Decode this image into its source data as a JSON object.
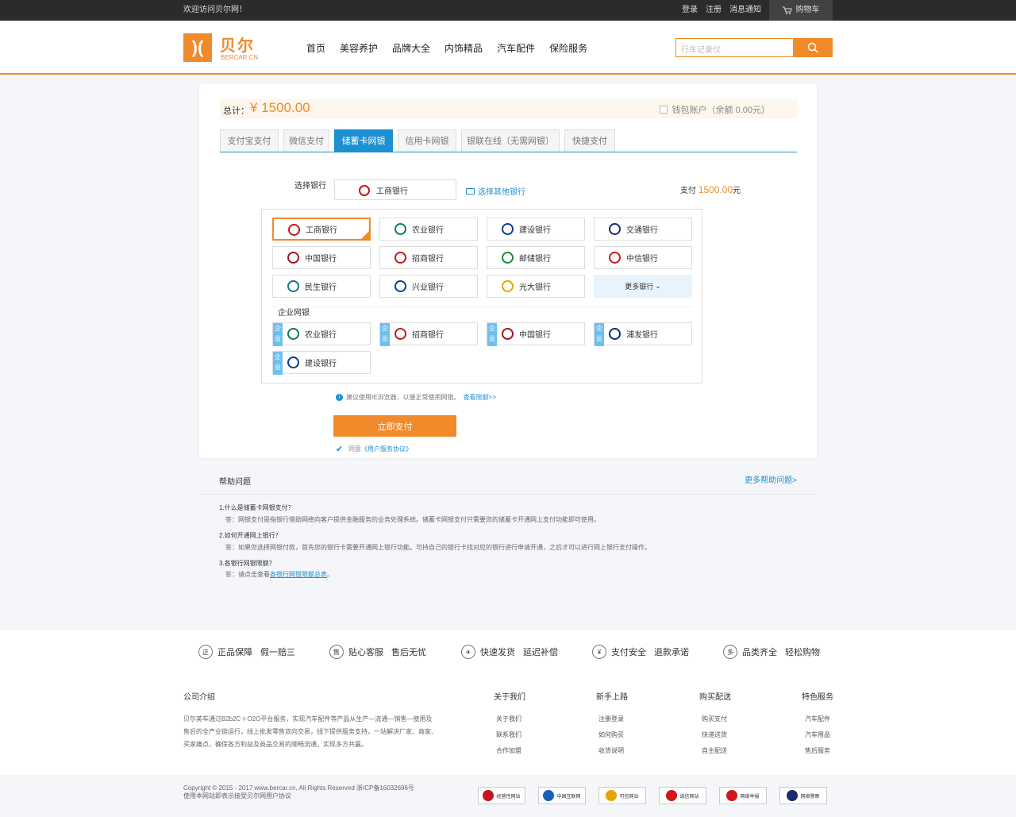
{
  "topbar": {
    "welcome": "欢迎访问贝尔网！",
    "links": [
      "登录",
      "注册",
      "消息通知"
    ],
    "cart": "购物车"
  },
  "header": {
    "logo_cn": "贝尔",
    "logo_en": "BERCAR.CN",
    "nav": [
      "首页",
      "美容养护",
      "品牌大全",
      "内饰精品",
      "汽车配件",
      "保险服务"
    ],
    "search_placeholder": "行车记录仪"
  },
  "payment": {
    "total_label": "总计：",
    "total_amount": "¥ 1500.00",
    "wallet": "钱包账户（余额 0.00元）",
    "tabs": [
      "支付宝支付",
      "微信支付",
      "储蓄卡网银",
      "信用卡网银",
      "银联在线（无需网银）",
      "快捷支付"
    ],
    "active_tab": "储蓄卡网银",
    "select_bank_label": "选择银行",
    "selected_bank": "工商银行",
    "other_bank": "选择其他银行",
    "pay_label": "支付",
    "pay_amount": "1500.00",
    "pay_unit": "元",
    "banks": [
      "工商银行",
      "农业银行",
      "建设银行",
      "交通银行",
      "中国银行",
      "招商银行",
      "邮储银行",
      "中信银行",
      "民生银行",
      "兴业银行",
      "光大银行"
    ],
    "more_banks": "更多银行",
    "enterprise_label": "企业网银",
    "enterprise_tag": "企业",
    "enterprise_banks": [
      "农业银行",
      "招商银行",
      "中国银行",
      "浦发银行",
      "建设银行"
    ],
    "tip": "建议使用IE浏览器，以便正常使用网银。",
    "tip_link": "查看限额>>",
    "pay_button": "立即支付",
    "agree": "同意",
    "agree_link": "《用户服务协议》",
    "colors": {
      "accent": "#f08a2a",
      "link": "#1d8fd3"
    }
  },
  "help": {
    "title": "帮助问题",
    "more": "更多帮助问题>",
    "items": [
      {
        "q": "1.什么是储蓄卡网银支付？",
        "a": "答：网银支付是指银行借助网络向客户提供金融服务的业务处理系统。储蓄卡网银支付只需要您的储蓄卡开通网上支付功能即可使用。"
      },
      {
        "q": "2.如何开通网上银行？",
        "a": "答：如果您选择网银付款，首先您的银行卡需要开通网上银行功能。可持自己的银行卡找对应的银行进行申请开通，之后才可以进行网上银行支付操作。"
      },
      {
        "q": "3.各银行网银限额？",
        "a_pre": "答：请点击查看",
        "a_link": "各银行网银限额总表",
        "a_post": "。"
      }
    ]
  },
  "footer": {
    "guarantees": [
      {
        "icon": "正",
        "main": "正品保障",
        "sub": "假一赔三"
      },
      {
        "icon": "售",
        "main": "贴心客服",
        "sub": "售后无忧"
      },
      {
        "icon": "✈",
        "main": "快速发货",
        "sub": "延迟补偿"
      },
      {
        "icon": "¥",
        "main": "支付安全",
        "sub": "退款承诺"
      },
      {
        "icon": "多",
        "main": "品类齐全",
        "sub": "轻松购物"
      }
    ],
    "about_title": "公司介绍",
    "about_text": "贝尔美车通过B2b2C＋O2O平台服务，实现汽车配件等产品从生产—流通—销售—使用及售后的全产业链运行，线上批发零售双向交易，线下提供服务支持，一站解决厂家、商家、买家痛点，确保各方利益及商品交易的顺畅流通，实现多方共赢。",
    "columns": [
      {
        "title": "关于我们",
        "items": [
          "关于我们",
          "联系我们",
          "合作加盟"
        ]
      },
      {
        "title": "新手上路",
        "items": [
          "注册登录",
          "如何购买",
          "收货说明"
        ]
      },
      {
        "title": "购买配送",
        "items": [
          "购买支付",
          "快递送货",
          "自主配送"
        ]
      },
      {
        "title": "特色服务",
        "items": [
          "汽车配件",
          "汽车用品",
          "售后服务"
        ]
      }
    ],
    "copyright": "Copyright © 2015 - 2017 www.bercar.cn, All Rights Reserved 浙ICP备16032696号",
    "agreement": "使用本网站即表示接受贝尔网用户协议",
    "badges": [
      "经营性网站",
      "中国互联网",
      "可信网站",
      "诚信网站",
      "网络举报",
      "网络警察"
    ]
  }
}
